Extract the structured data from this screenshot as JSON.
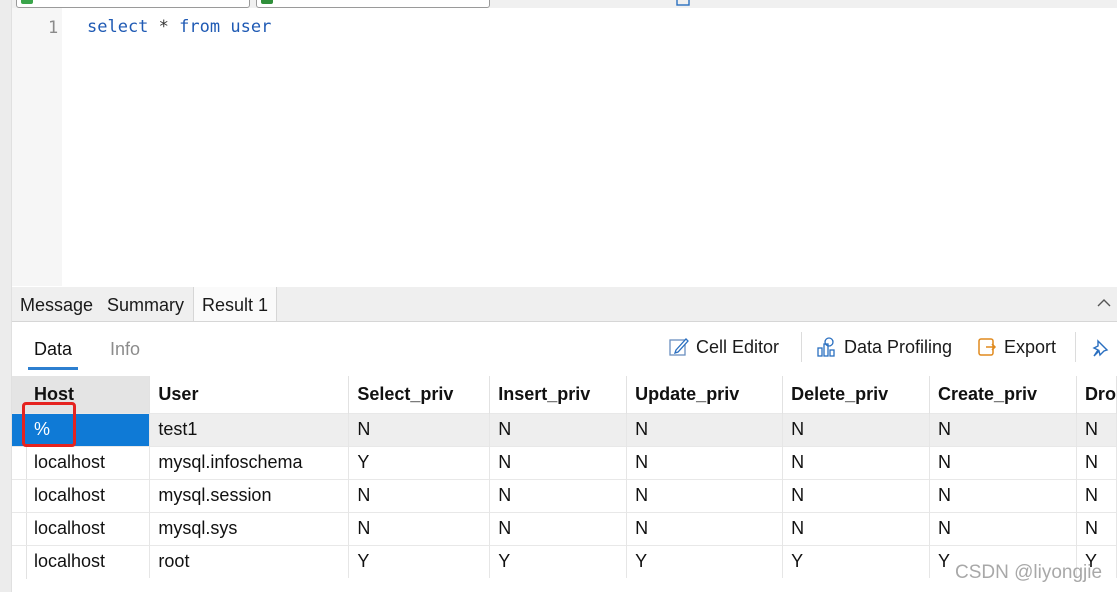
{
  "editor": {
    "line_number": "1",
    "sql_keyword_select": "select",
    "sql_star": "*",
    "sql_keyword_from": "from",
    "sql_table": "user"
  },
  "result_tabs": [
    {
      "label": "Message"
    },
    {
      "label": "Summary"
    },
    {
      "label": "Result 1"
    }
  ],
  "sub_tabs": {
    "data": "Data",
    "info": "Info"
  },
  "toolbar": {
    "cell_editor": "Cell Editor",
    "data_profiling": "Data Profiling",
    "export": "Export"
  },
  "grid": {
    "columns": [
      "Host",
      "User",
      "Select_priv",
      "Insert_priv",
      "Update_priv",
      "Delete_priv",
      "Create_priv",
      "Dro"
    ],
    "rows": [
      [
        "%",
        "test1",
        "N",
        "N",
        "N",
        "N",
        "N",
        "N"
      ],
      [
        "localhost",
        "mysql.infoschema",
        "Y",
        "N",
        "N",
        "N",
        "N",
        "N"
      ],
      [
        "localhost",
        "mysql.session",
        "N",
        "N",
        "N",
        "N",
        "N",
        "N"
      ],
      [
        "localhost",
        "mysql.sys",
        "N",
        "N",
        "N",
        "N",
        "N",
        "N"
      ],
      [
        "localhost",
        "root",
        "Y",
        "Y",
        "Y",
        "Y",
        "Y",
        "Y"
      ]
    ]
  },
  "watermark": "CSDN @liyongjie",
  "colors": {
    "selection": "#0f7ad6",
    "highlight_border": "#e5231f",
    "sql_keyword": "#1f5ab4"
  }
}
